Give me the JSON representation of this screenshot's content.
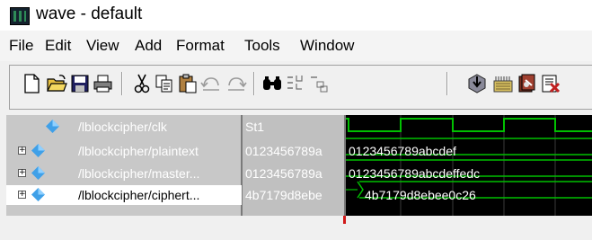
{
  "window": {
    "title": "wave - default",
    "app_icon": "wave-window-icon"
  },
  "menu": {
    "items": [
      "File",
      "Edit",
      "View",
      "Add",
      "Format",
      "Tools",
      "Window"
    ]
  },
  "toolbar": {
    "buttons": [
      "new-file-icon",
      "open-folder-icon",
      "save-icon",
      "print-icon",
      "cut-icon",
      "copy-icon",
      "paste-icon",
      "undo-icon",
      "redo-icon",
      "find-icon",
      "wave-compress-icon",
      "wave-expand-icon",
      "simulate-icon",
      "compile-icon",
      "dataflow-icon",
      "break-icon"
    ]
  },
  "signals": [
    {
      "name": "/lblockcipher/clk",
      "value": "St1",
      "expandable": false,
      "wave_text": ""
    },
    {
      "name": "/lblockcipher/plaintext",
      "value": "0123456789a",
      "expandable": true,
      "wave_text": "0123456789abcdef"
    },
    {
      "name": "/lblockcipher/master...",
      "value": "0123456789a",
      "expandable": true,
      "wave_text": "0123456789abcdeffedc"
    },
    {
      "name": "/lblockcipher/ciphert...",
      "value": "4b7179d8ebe",
      "expandable": true,
      "wave_text": "4b7179d8ebee0c26"
    }
  ],
  "colors": {
    "wave_signal": "#00c000",
    "wave_background": "#000000",
    "signal_icon": "#3fa0e8",
    "cursor_marker": "#d01818"
  }
}
